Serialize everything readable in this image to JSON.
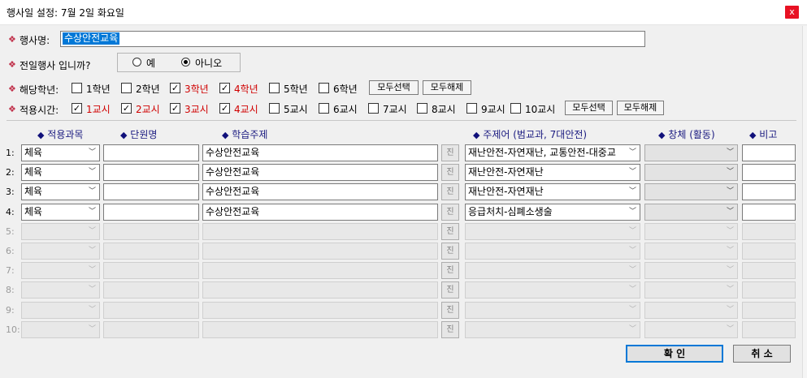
{
  "window": {
    "title": "행사일 설정:  7월  2일  화요일",
    "close": "x"
  },
  "event_name": {
    "label": "행사명:",
    "value": "수상안전교육"
  },
  "all_day": {
    "label": "전일행사 입니까?",
    "options": [
      "예",
      "아니오"
    ],
    "selected": "아니오"
  },
  "grades": {
    "label": "해당학년:",
    "items": [
      {
        "label": "1학년",
        "checked": false
      },
      {
        "label": "2학년",
        "checked": false
      },
      {
        "label": "3학년",
        "checked": true
      },
      {
        "label": "4학년",
        "checked": true
      },
      {
        "label": "5학년",
        "checked": false
      },
      {
        "label": "6학년",
        "checked": false
      }
    ],
    "select_all": "모두선택",
    "clear_all": "모두해제"
  },
  "periods": {
    "label": "적용시간:",
    "items": [
      {
        "label": "1교시",
        "checked": true
      },
      {
        "label": "2교시",
        "checked": true
      },
      {
        "label": "3교시",
        "checked": true
      },
      {
        "label": "4교시",
        "checked": true
      },
      {
        "label": "5교시",
        "checked": false
      },
      {
        "label": "6교시",
        "checked": false
      },
      {
        "label": "7교시",
        "checked": false
      },
      {
        "label": "8교시",
        "checked": false
      },
      {
        "label": "9교시",
        "checked": false
      },
      {
        "label": "10교시",
        "checked": false
      }
    ],
    "select_all": "모두선택",
    "clear_all": "모두해제"
  },
  "table": {
    "headers": [
      "적용과목",
      "단원명",
      "학습주제",
      "주제어 (범교과, 7대안전)",
      "창체 (활동)",
      "비고"
    ],
    "jin_label": "진",
    "rows": [
      {
        "num": "1:",
        "subject": "체육",
        "unit": "",
        "topic": "수상안전교육",
        "keyword": "재난안전-자연재난, 교통안전-대중교",
        "creative": "",
        "note": "",
        "enabled": true
      },
      {
        "num": "2:",
        "subject": "체육",
        "unit": "",
        "topic": "수상안전교육",
        "keyword": "재난안전-자연재난",
        "creative": "",
        "note": "",
        "enabled": true
      },
      {
        "num": "3:",
        "subject": "체육",
        "unit": "",
        "topic": "수상안전교육",
        "keyword": "재난안전-자연재난",
        "creative": "",
        "note": "",
        "enabled": true
      },
      {
        "num": "4:",
        "subject": "체육",
        "unit": "",
        "topic": "수상안전교육",
        "keyword": "응급처치-심폐소생술",
        "creative": "",
        "note": "",
        "enabled": true
      },
      {
        "num": "5:",
        "subject": "",
        "unit": "",
        "topic": "",
        "keyword": "",
        "creative": "",
        "note": "",
        "enabled": false
      },
      {
        "num": "6:",
        "subject": "",
        "unit": "",
        "topic": "",
        "keyword": "",
        "creative": "",
        "note": "",
        "enabled": false
      },
      {
        "num": "7:",
        "subject": "",
        "unit": "",
        "topic": "",
        "keyword": "",
        "creative": "",
        "note": "",
        "enabled": false
      },
      {
        "num": "8:",
        "subject": "",
        "unit": "",
        "topic": "",
        "keyword": "",
        "creative": "",
        "note": "",
        "enabled": false
      },
      {
        "num": "9:",
        "subject": "",
        "unit": "",
        "topic": "",
        "keyword": "",
        "creative": "",
        "note": "",
        "enabled": false
      },
      {
        "num": "10:",
        "subject": "",
        "unit": "",
        "topic": "",
        "keyword": "",
        "creative": "",
        "note": "",
        "enabled": false
      }
    ]
  },
  "buttons": {
    "ok": "확 인",
    "cancel": "취 소"
  },
  "colors": {
    "selection": "#0078d7",
    "checked_label": "#d00000",
    "header_text": "#1a1a80",
    "bullet": "#c0304a",
    "close": "#e81123"
  },
  "icons": {
    "bullet": "diamond-icon",
    "dropdown": "chevron-down-icon",
    "check": "check-icon"
  }
}
